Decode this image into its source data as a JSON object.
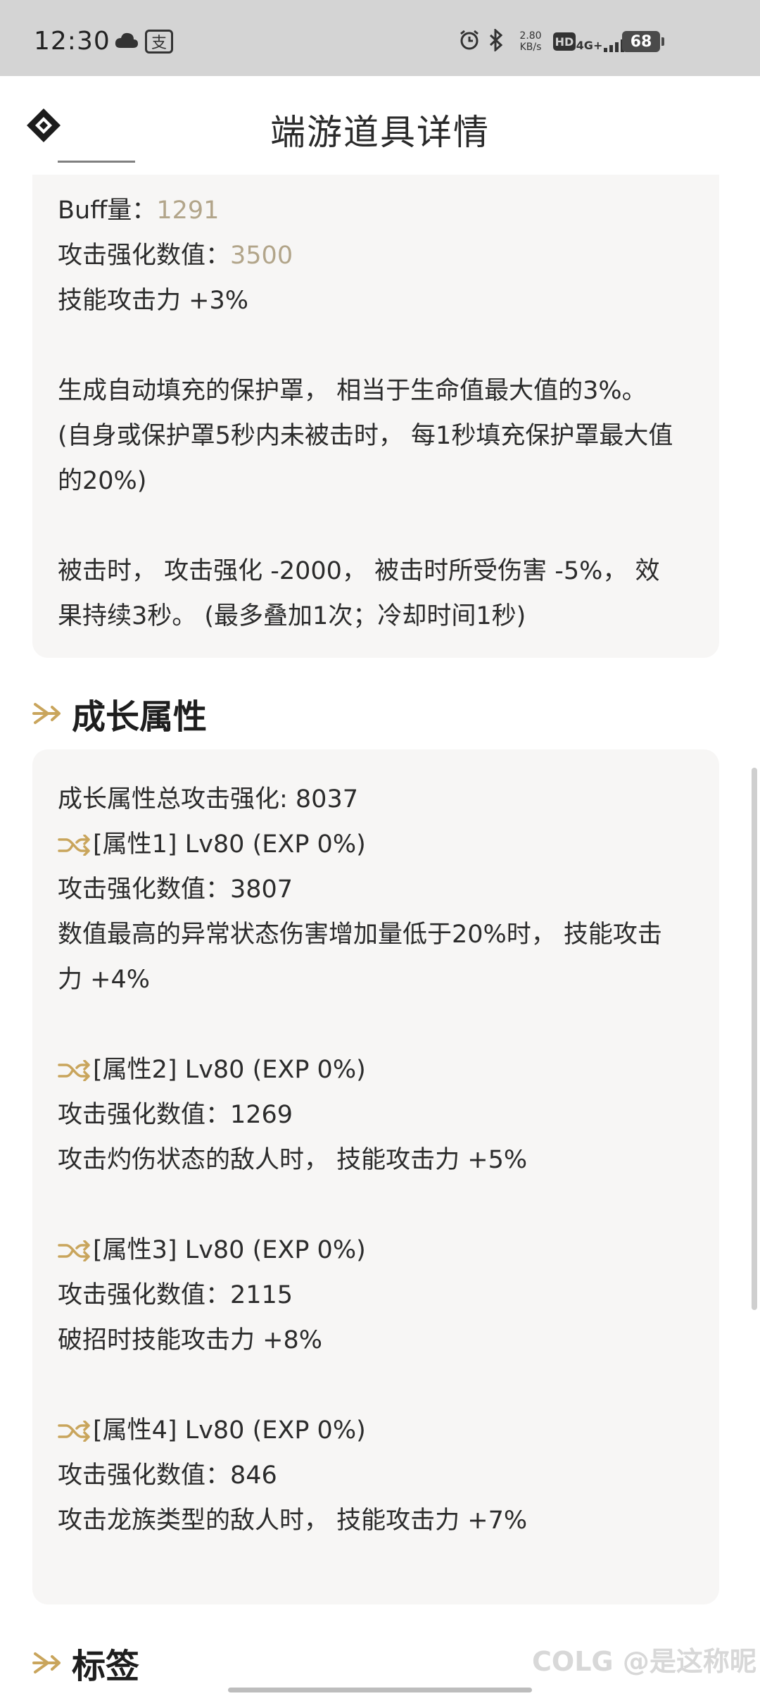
{
  "status_bar": {
    "time": "12:30",
    "pay_glyph": "支",
    "speed_top": "2.80",
    "speed_bottom": "KB/s",
    "hd": "HD",
    "network": "4G+",
    "battery": "68"
  },
  "header": {
    "title": "端游道具详情"
  },
  "buff_card": {
    "buff_label": "Buff量：",
    "buff_value": "1291",
    "atk_label": "攻击强化数值：",
    "atk_value": "3500",
    "skill": "技能攻击力 +3%",
    "shield_1": "生成自动填充的保护罩， 相当于生命值最大值的3%。",
    "shield_2": "(自身或保护罩5秒内未被击时， 每1秒填充保护罩最大值",
    "shield_3": "的20%)",
    "hit_1": "被击时， 攻击强化 -2000， 被击时所受伤害 -5%， 效",
    "hit_2": "果持续3秒。 (最多叠加1次；冷却时间1秒)"
  },
  "growth_section": {
    "title": "成长属性",
    "total": "成长属性总攻击强化: 8037",
    "attributes": [
      {
        "header": "[属性1] Lv80 (EXP 0%)",
        "atk": "攻击强化数值：3807",
        "desc_1": "数值最高的异常状态伤害增加量低于20%时， 技能攻击",
        "desc_2": "力 +4%"
      },
      {
        "header": "[属性2] Lv80 (EXP 0%)",
        "atk": "攻击强化数值：1269",
        "desc_1": "攻击灼伤状态的敌人时， 技能攻击力 +5%"
      },
      {
        "header": "[属性3] Lv80 (EXP 0%)",
        "atk": "攻击强化数值：2115",
        "desc_1": "破招时技能攻击力 +8%"
      },
      {
        "header": "[属性4] Lv80 (EXP 0%)",
        "atk": "攻击强化数值：846",
        "desc_1": "攻击龙族类型的敌人时， 技能攻击力 +7%"
      }
    ]
  },
  "tags_section": {
    "title": "标签"
  },
  "watermark": "@是这称昵",
  "watermark_logo": "COLG",
  "colors": {
    "gold": "#b2a58a",
    "arrow": "#c9a55c",
    "card_bg": "#f7f6f5"
  },
  "icons": [
    "cloud-icon",
    "alarm-icon",
    "bluetooth-icon",
    "signal-icon",
    "battery-icon",
    "app-logo-icon",
    "section-arrow-icon",
    "shuffle-icon"
  ]
}
